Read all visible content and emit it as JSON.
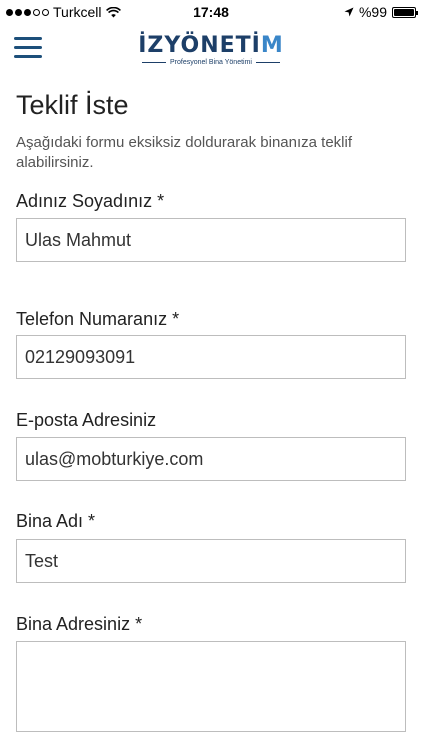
{
  "status_bar": {
    "carrier": "Turkcell",
    "time": "17:48",
    "battery_text": "%99",
    "battery_level": 0.99
  },
  "header": {
    "logo_main_left": "İZYÖNETİ",
    "logo_main_right": "M",
    "logo_subtitle": "Profesyonel Bina Yönetimi"
  },
  "page": {
    "title": "Teklif İste",
    "description": "Aşağıdaki formu eksiksiz doldurarak binanıza teklif alabilirsiniz."
  },
  "form": {
    "name": {
      "label": "Adınız Soyadınız *",
      "value": "Ulas Mahmut"
    },
    "phone": {
      "label": "Telefon Numaranız *",
      "value": "02129093091"
    },
    "email": {
      "label": "E-posta Adresiniz",
      "value": "ulas@mobturkiye.com"
    },
    "building_name": {
      "label": "Bina Adı *",
      "value": "Test"
    },
    "building_address": {
      "label": "Bina Adresiniz *",
      "value": ""
    }
  }
}
